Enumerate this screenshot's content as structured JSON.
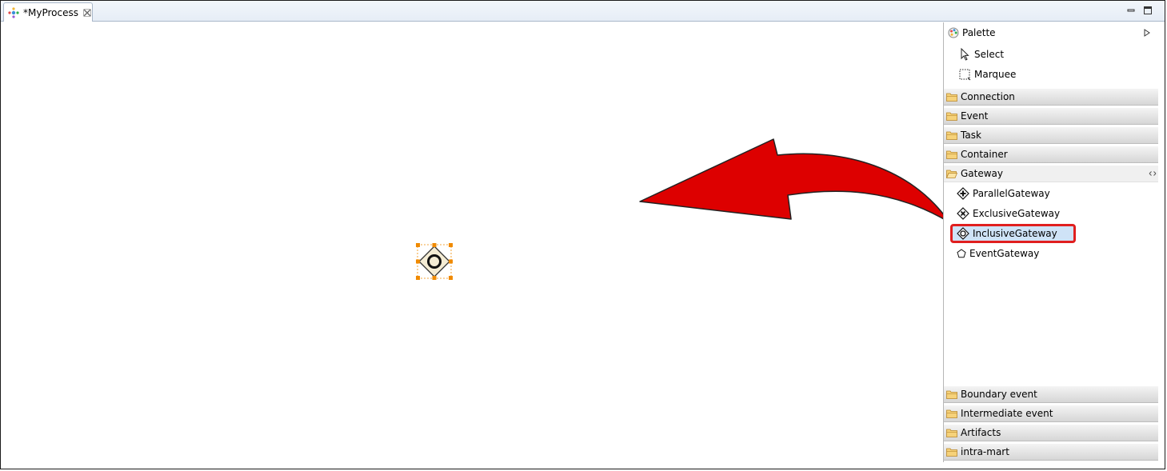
{
  "editor": {
    "tab_title": "*MyProcess",
    "tab_close_icon": "close-icon"
  },
  "palette": {
    "title": "Palette",
    "tools": [
      {
        "label": "Select",
        "icon": "pointer-icon"
      },
      {
        "label": "Marquee",
        "icon": "marquee-icon"
      }
    ],
    "drawers_top": [
      {
        "label": "Connection"
      },
      {
        "label": "Event"
      },
      {
        "label": "Task"
      },
      {
        "label": "Container"
      }
    ],
    "gateway_drawer": {
      "label": "Gateway",
      "items": [
        {
          "label": "ParallelGateway",
          "icon": "parallel-gateway-icon"
        },
        {
          "label": "ExclusiveGateway",
          "icon": "exclusive-gateway-icon"
        },
        {
          "label": "InclusiveGateway",
          "icon": "inclusive-gateway-icon",
          "selected": true
        },
        {
          "label": "EventGateway",
          "icon": "event-gateway-icon"
        }
      ]
    },
    "drawers_bottom": [
      {
        "label": "Boundary event"
      },
      {
        "label": "Intermediate event"
      },
      {
        "label": "Artifacts"
      },
      {
        "label": "intra-mart"
      }
    ]
  },
  "colors": {
    "highlight_border": "#e01f1f",
    "highlight_fill": "#cfe3f7",
    "arrow": "#dd0000",
    "selection_handle": "#f08a00"
  }
}
